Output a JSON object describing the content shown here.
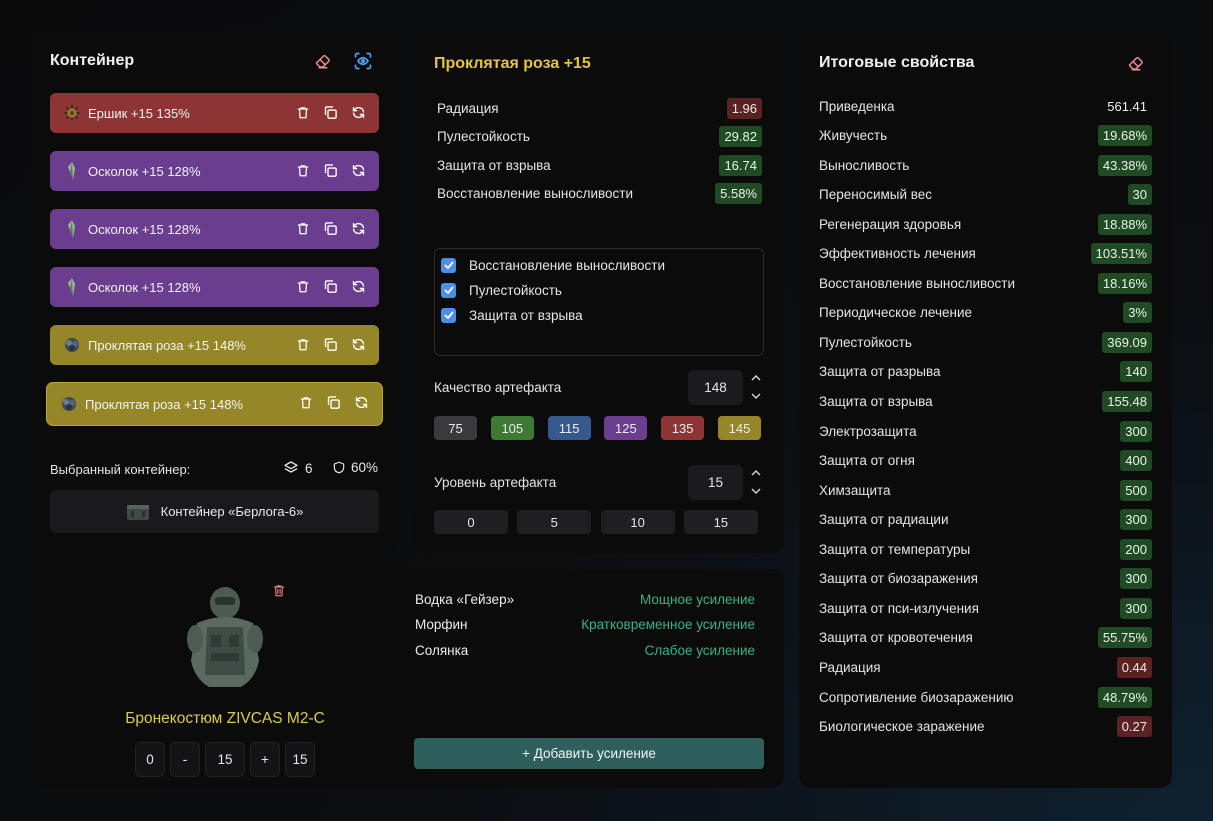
{
  "container_panel": {
    "title": "Контейнер",
    "artifacts": [
      {
        "label": "Ершик +15 135%",
        "color": "red",
        "icon": "hedgehog-artifact-icon"
      },
      {
        "label": "Осколок +15 128%",
        "color": "purple",
        "icon": "shard-artifact-icon"
      },
      {
        "label": "Осколок +15 128%",
        "color": "purple",
        "icon": "shard-artifact-icon"
      },
      {
        "label": "Осколок +15 128%",
        "color": "purple",
        "icon": "shard-artifact-icon"
      },
      {
        "label": "Проклятая роза +15 148%",
        "color": "yellow",
        "icon": "rose-artifact-icon"
      },
      {
        "label": "Проклятая роза +15 148%",
        "color": "yellow",
        "icon": "rose-artifact-icon"
      }
    ],
    "selected_label": "Выбранный контейнер:",
    "slots": "6",
    "protection": "60%",
    "container_name": "Контейнер «Берлога-6»"
  },
  "artifact_panel": {
    "title": "Проклятая роза +15",
    "stats": [
      {
        "name": "Радиация",
        "value": "1.96",
        "kind": "r"
      },
      {
        "name": "Пулестойкость",
        "value": "29.82",
        "kind": "g"
      },
      {
        "name": "Защита от взрыва",
        "value": "16.74",
        "kind": "g"
      },
      {
        "name": "Восстановление выносливости",
        "value": "5.58%",
        "kind": "g"
      }
    ],
    "checkboxes": [
      "Восстановление выносливости",
      "Пулестойкость",
      "Защита от взрыва"
    ],
    "quality_label": "Качество артефакта",
    "quality_value": "148",
    "quality_presets": [
      {
        "label": "75",
        "color": "#3a3a3d"
      },
      {
        "label": "105",
        "color": "#3f7a34"
      },
      {
        "label": "115",
        "color": "#36588c"
      },
      {
        "label": "125",
        "color": "#6a3d8e"
      },
      {
        "label": "135",
        "color": "#8d3535"
      },
      {
        "label": "145",
        "color": "#958728"
      }
    ],
    "level_label": "Уровень артефакта",
    "level_value": "15",
    "level_presets": [
      "0",
      "5",
      "10",
      "15"
    ]
  },
  "properties_panel": {
    "title": "Итоговые свойства",
    "rows": [
      {
        "name": "Приведенка",
        "value": "561.41",
        "kind": "n"
      },
      {
        "name": "Живучесть",
        "value": "19.68%",
        "kind": "g"
      },
      {
        "name": "Выносливость",
        "value": "43.38%",
        "kind": "g"
      },
      {
        "name": "Переносимый вес",
        "value": "30",
        "kind": "g"
      },
      {
        "name": "Регенерация здоровья",
        "value": "18.88%",
        "kind": "g"
      },
      {
        "name": "Эффективность лечения",
        "value": "103.51%",
        "kind": "g"
      },
      {
        "name": "Восстановление выносливости",
        "value": "18.16%",
        "kind": "g"
      },
      {
        "name": "Периодическое лечение",
        "value": "3%",
        "kind": "g"
      },
      {
        "name": "Пулестойкость",
        "value": "369.09",
        "kind": "g"
      },
      {
        "name": "Защита от разрыва",
        "value": "140",
        "kind": "g"
      },
      {
        "name": "Защита от взрыва",
        "value": "155.48",
        "kind": "g"
      },
      {
        "name": "Электрозащита",
        "value": "300",
        "kind": "g"
      },
      {
        "name": "Защита от огня",
        "value": "400",
        "kind": "g"
      },
      {
        "name": "Химзащита",
        "value": "500",
        "kind": "g"
      },
      {
        "name": "Защита от радиации",
        "value": "300",
        "kind": "g"
      },
      {
        "name": "Защита от температуры",
        "value": "200",
        "kind": "g"
      },
      {
        "name": "Защита от биозаражения",
        "value": "300",
        "kind": "g"
      },
      {
        "name": "Защита от пси-излучения",
        "value": "300",
        "kind": "g"
      },
      {
        "name": "Защита от кровотечения",
        "value": "55.75%",
        "kind": "g"
      },
      {
        "name": "Радиация",
        "value": "0.44",
        "kind": "r"
      },
      {
        "name": "Сопротивление биозаражению",
        "value": "48.79%",
        "kind": "g"
      },
      {
        "name": "Биологическое заражение",
        "value": "0.27",
        "kind": "r"
      }
    ]
  },
  "armor_panel": {
    "armor_name": "Бронекостюм ZIVCAS M2-C",
    "stepper": {
      "min": "0",
      "minus": "-",
      "value": "15",
      "plus": "+",
      "max": "15"
    },
    "boosts": [
      {
        "name": "Водка «Гейзер»",
        "effect": "Мощное усиление"
      },
      {
        "name": "Морфин",
        "effect": "Кратковременное усиление"
      },
      {
        "name": "Солянка",
        "effect": "Слабое усиление"
      }
    ],
    "add_boost_label": "+ Добавить усиление"
  }
}
